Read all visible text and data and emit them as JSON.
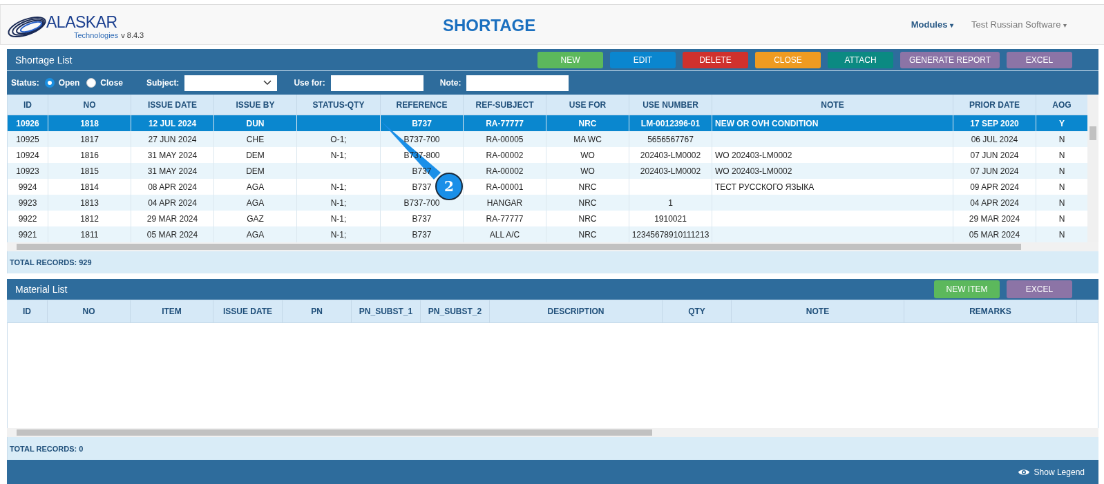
{
  "header": {
    "brand": "ALASKAR",
    "brand_sub": "Technologies",
    "version": "v 8.4.3",
    "title": "SHORTAGE",
    "nav": [
      {
        "label": "Modules",
        "kind": "primary",
        "caret": "▾"
      },
      {
        "label": "Test Russian Software",
        "kind": "secondary",
        "caret": "▾"
      }
    ]
  },
  "shortage_list": {
    "title": "Shortage List",
    "buttons": [
      {
        "label": "NEW",
        "kind": "new"
      },
      {
        "label": "EDIT",
        "kind": "edit"
      },
      {
        "label": "DELETE",
        "kind": "delete"
      },
      {
        "label": "CLOSE",
        "kind": "close"
      },
      {
        "label": "ATTACH",
        "kind": "attach"
      },
      {
        "label": "GENERATE REPORT",
        "kind": "report"
      },
      {
        "label": "EXCEL",
        "kind": "excel"
      }
    ],
    "filters": {
      "status_label": "Status:",
      "status_options": [
        {
          "label": "Open",
          "selected": true
        },
        {
          "label": "Close",
          "selected": false
        }
      ],
      "subject_label": "Subject:",
      "use_for_label": "Use for:",
      "note_label": "Note:"
    },
    "columns": [
      "ID",
      "NO",
      "ISSUE DATE",
      "ISSUE BY",
      "STATUS-QTY",
      "REFERENCE",
      "REF-SUBJECT",
      "USE FOR",
      "USE NUMBER",
      "NOTE",
      "PRIOR DATE",
      "AOG"
    ],
    "rows": [
      {
        "selected": true,
        "cells": [
          "10926",
          "1818",
          "12 JUL 2024",
          "DUN",
          "",
          "B737",
          "RA-77777",
          "NRC",
          "LM-0012396-01",
          "NEW OR OVH CONDITION",
          "17 SEP 2020",
          "Y"
        ]
      },
      {
        "selected": false,
        "cells": [
          "10925",
          "1817",
          "27 JUN 2024",
          "CHE",
          "O-1;",
          "B737-700",
          "RA-00005",
          "MA WC",
          "5656567767",
          "",
          "06 JUL 2024",
          "N"
        ]
      },
      {
        "selected": false,
        "cells": [
          "10924",
          "1816",
          "31 MAY 2024",
          "DEM",
          "N-1;",
          "B737-800",
          "RA-00002",
          "WO",
          "202403-LM0002",
          "WO 202403-LM0002",
          "07 JUN 2024",
          "N"
        ]
      },
      {
        "selected": false,
        "cells": [
          "10923",
          "1815",
          "31 MAY 2024",
          "DEM",
          "",
          "B737",
          "RA-00002",
          "WO",
          "202403-LM0002",
          "WO 202403-LM0002",
          "07 JUN 2024",
          "N"
        ]
      },
      {
        "selected": false,
        "cells": [
          "9924",
          "1814",
          "08 APR 2024",
          "AGA",
          "N-1;",
          "B737",
          "RA-00001",
          "NRC",
          "",
          "ТЕСТ РУССКОГО ЯЗЫКА",
          "09 APR 2024",
          "N"
        ]
      },
      {
        "selected": false,
        "cells": [
          "9923",
          "1813",
          "04 APR 2024",
          "AGA",
          "N-1;",
          "B737-700",
          "HANGAR",
          "NRC",
          "1",
          "",
          "04 APR 2024",
          "N"
        ]
      },
      {
        "selected": false,
        "cells": [
          "9922",
          "1812",
          "29 MAR 2024",
          "GAZ",
          "N-1;",
          "B737",
          "RA-77777",
          "NRC",
          "1910021",
          "",
          "29 MAR 2024",
          "N"
        ]
      },
      {
        "selected": false,
        "cells": [
          "9921",
          "1811",
          "05 MAR 2024",
          "AGA",
          "N-1;",
          "B737",
          "ALL A/C",
          "NRC",
          "12345678910111213",
          "",
          "05 MAR 2024",
          "N"
        ]
      }
    ],
    "total": "TOTAL RECORDS: 929"
  },
  "material_list": {
    "title": "Material List",
    "buttons": [
      {
        "label": "NEW ITEM",
        "kind": "new"
      },
      {
        "label": "EXCEL",
        "kind": "excel"
      }
    ],
    "columns": [
      "ID",
      "NO",
      "ITEM",
      "ISSUE DATE",
      "PN",
      "PN_SUBST_1",
      "PN_SUBST_2",
      "DESCRIPTION",
      "QTY",
      "NOTE",
      "REMARKS"
    ],
    "total": "TOTAL RECORDS: 0"
  },
  "footer": {
    "legend": "Show Legend"
  },
  "callout": {
    "number": "2"
  }
}
